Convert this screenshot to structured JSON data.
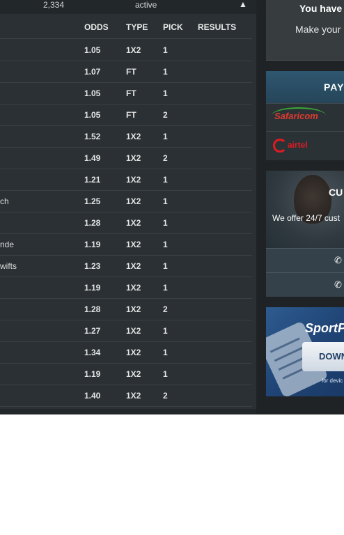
{
  "status_bar": {
    "count": "2,334",
    "status": "active",
    "toggle_icon": "caret-up-icon"
  },
  "table": {
    "headers": {
      "odds": "ODDS",
      "type": "TYPE",
      "pick": "PICK",
      "results": "RESULTS"
    },
    "rows": [
      {
        "name": "",
        "odds": "1.05",
        "type": "1X2",
        "pick": "1",
        "result": ""
      },
      {
        "name": "",
        "odds": "1.07",
        "type": "FT",
        "pick": "1",
        "result": ""
      },
      {
        "name": "",
        "odds": "1.05",
        "type": "FT",
        "pick": "1",
        "result": ""
      },
      {
        "name": "",
        "odds": "1.05",
        "type": "FT",
        "pick": "2",
        "result": ""
      },
      {
        "name": "",
        "odds": "1.52",
        "type": "1X2",
        "pick": "1",
        "result": ""
      },
      {
        "name": "",
        "odds": "1.49",
        "type": "1X2",
        "pick": "2",
        "result": ""
      },
      {
        "name": "",
        "odds": "1.21",
        "type": "1X2",
        "pick": "1",
        "result": ""
      },
      {
        "name": "ch",
        "odds": "1.25",
        "type": "1X2",
        "pick": "1",
        "result": ""
      },
      {
        "name": "",
        "odds": "1.28",
        "type": "1X2",
        "pick": "1",
        "result": ""
      },
      {
        "name": "nde",
        "odds": "1.19",
        "type": "1X2",
        "pick": "1",
        "result": ""
      },
      {
        "name": "wifts",
        "odds": "1.23",
        "type": "1X2",
        "pick": "1",
        "result": ""
      },
      {
        "name": "",
        "odds": "1.19",
        "type": "1X2",
        "pick": "1",
        "result": ""
      },
      {
        "name": "",
        "odds": "1.28",
        "type": "1X2",
        "pick": "2",
        "result": ""
      },
      {
        "name": "",
        "odds": "1.27",
        "type": "1X2",
        "pick": "1",
        "result": ""
      },
      {
        "name": "",
        "odds": "1.34",
        "type": "1X2",
        "pick": "1",
        "result": ""
      },
      {
        "name": "",
        "odds": "1.19",
        "type": "1X2",
        "pick": "1",
        "result": ""
      },
      {
        "name": "",
        "odds": "1.40",
        "type": "1X2",
        "pick": "2",
        "result": ""
      }
    ]
  },
  "sidebar": {
    "active_card": {
      "title": "You have",
      "subtitle": "Make your"
    },
    "payment": {
      "title": "PAY",
      "providers": [
        {
          "name": "Safaricom"
        },
        {
          "name": "airtel"
        }
      ]
    },
    "customer_care": {
      "title": "CU",
      "subtitle": "We offer 24/7 cust",
      "phone_icon": "phone-icon"
    },
    "app_promo": {
      "title": "SportP",
      "button_label": "DOWN",
      "footnote": "for devic"
    }
  },
  "colors": {
    "page_bg": "#1f2325",
    "table_bg": "#2a3033",
    "payment_header": "#2f5770",
    "safaricom": "#e03a2e",
    "airtel": "#e01b22",
    "app_bg": "#1f4475"
  }
}
